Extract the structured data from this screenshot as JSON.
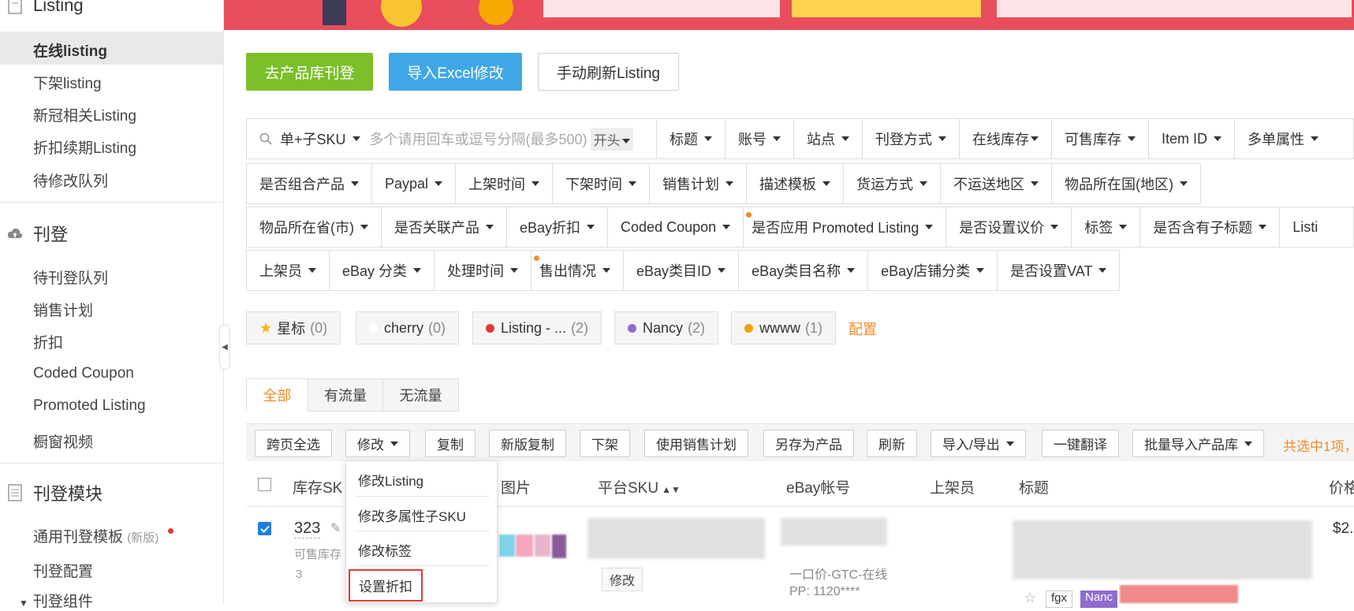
{
  "sidebar": {
    "sections": [
      {
        "label": "Listing",
        "icon": "listing-icon"
      },
      {
        "label": "刊登",
        "icon": "cloud-upload-icon"
      },
      {
        "label": "刊登模块",
        "icon": "document-icon"
      }
    ],
    "listing_items": [
      "在线listing",
      "下架listing",
      "新冠相关Listing",
      "折扣续期Listing",
      "待修改队列"
    ],
    "publish_items": [
      "待刊登队列",
      "销售计划",
      "折扣",
      "Coded Coupon",
      "Promoted Listing",
      "橱窗视频"
    ],
    "module_items": [
      {
        "label": "通用刊登模板",
        "badge": "(新版)"
      },
      {
        "label": "刊登配置",
        "badge": ""
      },
      {
        "label": "刊登组件",
        "badge": ""
      }
    ]
  },
  "actions": {
    "goto_library": "去产品库刊登",
    "import_excel": "导入Excel修改",
    "refresh_listing": "手动刷新Listing"
  },
  "filters": {
    "row1": [
      "单+子SKU",
      "多个请用回车或逗号分隔(最多500)",
      "开头",
      "标题",
      "账号",
      "站点",
      "刊登方式",
      "在线库存",
      "可售库存",
      "Item ID",
      "多单属性"
    ],
    "row2": [
      "是否组合产品",
      "Paypal",
      "上架时间",
      "下架时间",
      "销售计划",
      "描述模板",
      "货运方式",
      "不运送地区",
      "物品所在国(地区)"
    ],
    "row3": [
      "物品所在省(市)",
      "是否关联产品",
      "eBay折扣",
      "Coded Coupon",
      "是否应用 Promoted Listing",
      "是否设置议价",
      "标签",
      "是否含有子标题",
      "Listi"
    ],
    "row4": [
      "上架员",
      "eBay 分类",
      "处理时间",
      "售出情况",
      "eBay类目ID",
      "eBay类目名称",
      "eBay店铺分类",
      "是否设置VAT"
    ]
  },
  "tags": [
    {
      "label": "星标",
      "count": "(0)",
      "color": "#f5b800"
    },
    {
      "label": "cherry",
      "count": "(0)",
      "color": "#ffffff"
    },
    {
      "label": "Listing - ...",
      "count": "(2)",
      "color": "#e53935"
    },
    {
      "label": "Nancy",
      "count": "(2)",
      "color": "#8e6ccf"
    },
    {
      "label": "wwww",
      "count": "(1)",
      "color": "#f5a000"
    }
  ],
  "tags_config": "配置",
  "tabs": [
    "全部",
    "有流量",
    "无流量"
  ],
  "toolbar": {
    "buttons": [
      "跨页全选",
      "修改",
      "复制",
      "新版复制",
      "下架",
      "使用销售计划",
      "另存为产品",
      "刷新",
      "导入/导出",
      "一键翻译",
      "批量导入产品库"
    ],
    "selected_info": "共选中1项，"
  },
  "table": {
    "headers": [
      "库存SK",
      "图片",
      "平台SKU",
      "eBay帐号",
      "上架员",
      "标题",
      "价格"
    ],
    "row": {
      "sku": "323",
      "stock_label": "可售库存",
      "stock_value": "3",
      "edit_label": "修改",
      "listing_type": "一口价-GTC-在线",
      "pp": "PP: 1120****",
      "price": "$2.",
      "tag1": "fgx",
      "tag2": "Nanc"
    }
  },
  "dropdown": {
    "items": [
      "修改Listing",
      "修改多属性子SKU",
      "修改标签",
      "设置折扣"
    ],
    "highlighted": "设置折扣"
  },
  "colors": {
    "banner": "#ea4d5b",
    "green": "#7cbf2a",
    "blue": "#3fa7e6",
    "orange": "#f28c28",
    "highlight_red": "#e53935"
  }
}
